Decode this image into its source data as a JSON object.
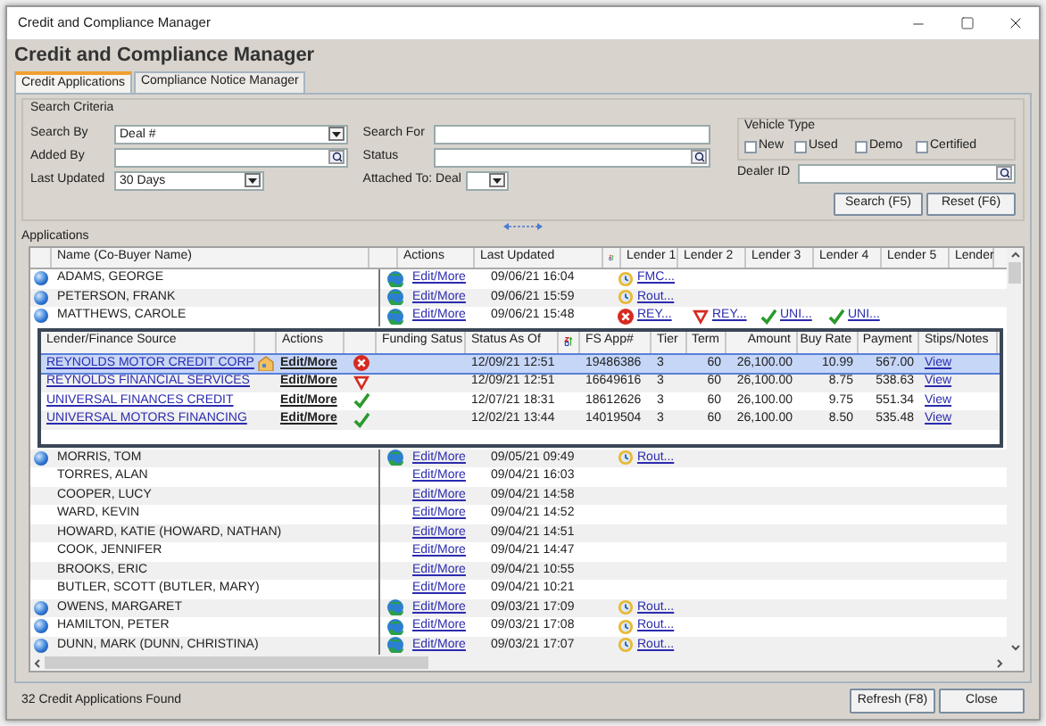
{
  "window": {
    "title": "Credit and Compliance Manager"
  },
  "heading": "Credit and Compliance Manager",
  "tabs": [
    {
      "label": "Credit Applications",
      "selected": true
    },
    {
      "label": "Compliance Notice Manager",
      "selected": false
    }
  ],
  "search_criteria": {
    "title": "Search Criteria",
    "left": [
      {
        "label": "Search By",
        "kind": "dropdown",
        "value": "Deal #"
      },
      {
        "label": "Added By",
        "kind": "lookup"
      },
      {
        "label": "Last Updated",
        "kind": "dropdown",
        "value": "30 Days"
      }
    ],
    "middle": [
      {
        "label": "Search For",
        "kind": "text"
      },
      {
        "label": "Status",
        "kind": "lookup"
      },
      {
        "label": "Attached To: Deal",
        "kind": "dropdown"
      }
    ],
    "vehicle_type": {
      "title": "Vehicle Type",
      "options": [
        {
          "label": "New",
          "checked": false
        },
        {
          "label": "Used",
          "checked": false
        },
        {
          "label": "Demo",
          "checked": false
        },
        {
          "label": "Certified",
          "checked": false
        }
      ]
    },
    "dealer_id": {
      "label": "Dealer ID",
      "kind": "lookup"
    }
  },
  "search_buttons": [
    "Search (F5)",
    "Reset (F6)"
  ],
  "applications": {
    "title": "Applications",
    "columns": [
      "Name (Co-Buyer Name)",
      "Actions",
      "Last Updated",
      "Lender 1",
      "Lender 2",
      "Lender 3",
      "Lender 4",
      "Lender 5",
      "Lender"
    ],
    "rows": [
      {
        "name": "ADAMS, GEORGE",
        "marked": true,
        "actions": "Edit/More",
        "last_updated": "09/06/21 16:04",
        "lenders": [
          {
            "kind": "pending",
            "text": "FMC..."
          }
        ]
      },
      {
        "name": "PETERSON, FRANK",
        "marked": true,
        "actions": "Edit/More",
        "last_updated": "09/06/21 15:59",
        "lenders": [
          {
            "kind": "pending",
            "text": "Rout..."
          }
        ]
      },
      {
        "name": "MATTHEWS, CAROLE",
        "marked": true,
        "actions": "Edit/More",
        "last_updated": "09/06/21 15:48",
        "lenders": [
          {
            "kind": "declined",
            "text": "REY..."
          },
          {
            "kind": "conditional",
            "text": "REY..."
          },
          {
            "kind": "approved",
            "text": "UNI..."
          },
          {
            "kind": "approved",
            "text": "UNI..."
          }
        ],
        "detail": {
          "columns": [
            "Lender/Finance Source",
            "Actions",
            "Funding Satus",
            "Status As Of",
            "FS App#",
            "Tier",
            "Term",
            "Amount",
            "Buy Rate",
            "Payment",
            "Stips/Notes"
          ],
          "rows": [
            {
              "source": "REYNOLDS MOTOR CREDIT CORP",
              "note_icon": true,
              "actions": "Edit/More",
              "kind": "declined",
              "status_as_of": "12/09/21 12:51",
              "fs_app": "19486386",
              "tier": "3",
              "term": "60",
              "amount": "26,100.00",
              "buy_rate": "10.99",
              "payment": "567.00",
              "stips": "View",
              "selected": true
            },
            {
              "source": "REYNOLDS FINANCIAL SERVICES",
              "note_icon": false,
              "actions": "Edit/More",
              "kind": "conditional",
              "status_as_of": "12/09/21 12:51",
              "fs_app": "16649616",
              "tier": "3",
              "term": "60",
              "amount": "26,100.00",
              "buy_rate": "8.75",
              "payment": "538.63",
              "stips": "View",
              "selected": false
            },
            {
              "source": "UNIVERSAL FINANCES CREDIT",
              "note_icon": false,
              "actions": "Edit/More",
              "kind": "approved",
              "status_as_of": "12/07/21 18:31",
              "fs_app": "18612626",
              "tier": "3",
              "term": "60",
              "amount": "26,100.00",
              "buy_rate": "9.75",
              "payment": "551.34",
              "stips": "View",
              "selected": false
            },
            {
              "source": "UNIVERSAL MOTORS FINANCING",
              "note_icon": false,
              "actions": "Edit/More",
              "kind": "approved",
              "status_as_of": "12/02/21 13:44",
              "fs_app": "14019504",
              "tier": "3",
              "term": "60",
              "amount": "26,100.00",
              "buy_rate": "8.50",
              "payment": "535.48",
              "stips": "View",
              "selected": false
            }
          ]
        }
      },
      {
        "name": "MORRIS, TOM",
        "marked": true,
        "actions": "Edit/More",
        "last_updated": "09/05/21 09:49",
        "lenders": [
          {
            "kind": "pending",
            "text": "Rout..."
          }
        ]
      },
      {
        "name": "TORRES, ALAN",
        "marked": false,
        "actions": "Edit/More",
        "last_updated": "09/04/21 16:03",
        "lenders": []
      },
      {
        "name": "COOPER, LUCY",
        "marked": false,
        "actions": "Edit/More",
        "last_updated": "09/04/21 14:58",
        "lenders": []
      },
      {
        "name": "WARD, KEVIN",
        "marked": false,
        "actions": "Edit/More",
        "last_updated": "09/04/21 14:52",
        "lenders": []
      },
      {
        "name": "HOWARD, KATIE (HOWARD, NATHAN)",
        "marked": false,
        "actions": "Edit/More",
        "last_updated": "09/04/21 14:51",
        "lenders": []
      },
      {
        "name": "COOK, JENNIFER",
        "marked": false,
        "actions": "Edit/More",
        "last_updated": "09/04/21 14:47",
        "lenders": []
      },
      {
        "name": "BROOKS, ERIC",
        "marked": false,
        "actions": "Edit/More",
        "last_updated": "09/04/21 10:55",
        "lenders": []
      },
      {
        "name": "BUTLER, SCOTT (BUTLER, MARY)",
        "marked": false,
        "actions": "Edit/More",
        "last_updated": "09/04/21 10:21",
        "lenders": []
      },
      {
        "name": "OWENS, MARGARET",
        "marked": true,
        "actions": "Edit/More",
        "last_updated": "09/03/21 17:09",
        "lenders": [
          {
            "kind": "pending",
            "text": "Rout..."
          }
        ]
      },
      {
        "name": "HAMILTON, PETER",
        "marked": true,
        "actions": "Edit/More",
        "last_updated": "09/03/21 17:08",
        "lenders": [
          {
            "kind": "pending",
            "text": "Rout..."
          }
        ]
      },
      {
        "name": "DUNN, MARK (DUNN, CHRISTINA)",
        "marked": true,
        "actions": "Edit/More",
        "last_updated": "09/03/21 17:07",
        "lenders": [
          {
            "kind": "pending",
            "text": "Rout..."
          }
        ]
      }
    ]
  },
  "status_bar": {
    "text": "32 Credit Applications Found",
    "buttons": [
      "Refresh (F8)",
      "Close"
    ]
  }
}
